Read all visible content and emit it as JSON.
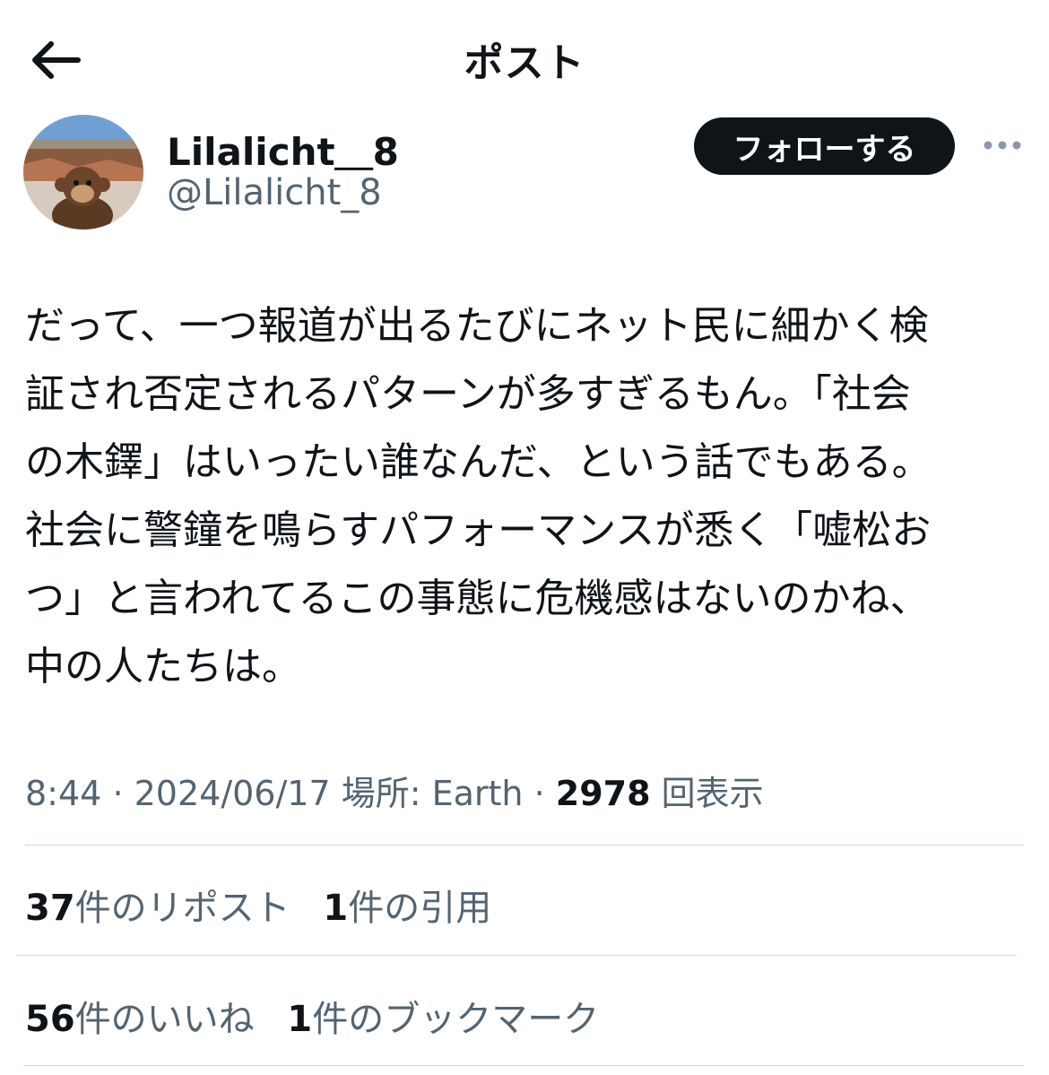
{
  "header": {
    "title": "ポスト",
    "back_icon": "arrow-left-icon"
  },
  "author": {
    "display_name": "Lilalicht＿8",
    "handle": "@Lilalicht_8",
    "follow_label": "フォローする",
    "more_icon": "more-horizontal-icon"
  },
  "post": {
    "lines": [
      "だって、一つ報道が出るたびにネット民に細かく検",
      "証され否定されるパターンが多すぎるもん。「社会",
      "の木鐸」はいったい誰なんだ、という話でもある。",
      "社会に警鐘を鳴らすパフォーマンスが悉く「嘘松お",
      "つ」と言われてるこの事態に危機感はないのかね、",
      "中の人たちは。"
    ],
    "time": "8:44",
    "date": "2024/06/17",
    "location_label": "場所: Earth",
    "views_count": "2978",
    "views_label": "回表示"
  },
  "stats": {
    "reposts_count": "37",
    "reposts_label": "件のリポスト",
    "quotes_count": "1",
    "quotes_label": "件の引用",
    "likes_count": "56",
    "likes_label": "件のいいね",
    "bookmarks_count": "1",
    "bookmarks_label": "件のブックマーク"
  },
  "colors": {
    "text_primary": "#0f1419",
    "text_secondary": "#536471",
    "divider": "#cfd9de",
    "follow_bg": "#0f1419"
  }
}
